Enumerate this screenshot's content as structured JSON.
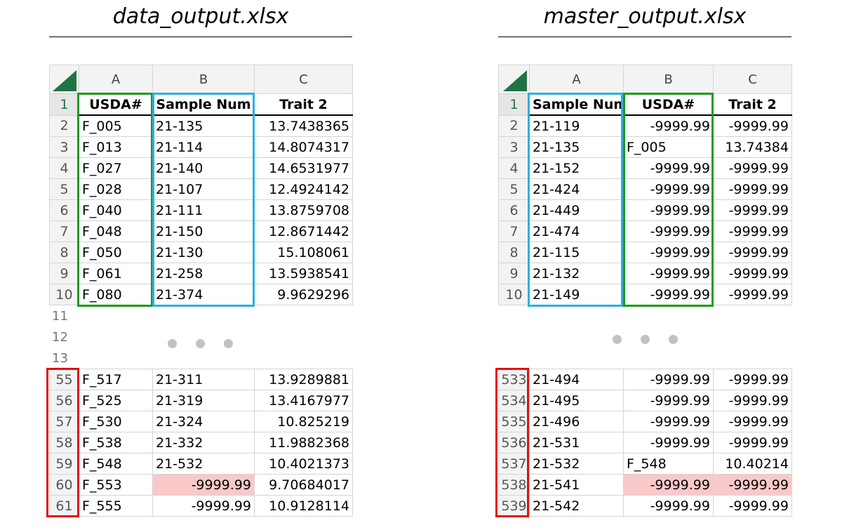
{
  "left": {
    "title": "data_output.xlsx",
    "columns": [
      "A",
      "B",
      "C"
    ],
    "header": [
      "USDA#",
      "Sample Num",
      "Trait 2"
    ],
    "top_rows": [
      {
        "n": "2",
        "a": "F_005",
        "b": "21-135",
        "c": "13.7438365"
      },
      {
        "n": "3",
        "a": "F_013",
        "b": "21-114",
        "c": "14.8074317"
      },
      {
        "n": "4",
        "a": "F_027",
        "b": "21-140",
        "c": "14.6531977"
      },
      {
        "n": "5",
        "a": "F_028",
        "b": "21-107",
        "c": "12.4924142"
      },
      {
        "n": "6",
        "a": "F_040",
        "b": "21-111",
        "c": "13.8759708"
      },
      {
        "n": "7",
        "a": "F_048",
        "b": "21-150",
        "c": "12.8671442"
      },
      {
        "n": "8",
        "a": "F_050",
        "b": "21-130",
        "c": "15.108061"
      },
      {
        "n": "9",
        "a": "F_061",
        "b": "21-258",
        "c": "13.5938541"
      },
      {
        "n": "10",
        "a": "F_080",
        "b": "21-374",
        "c": "9.9629296"
      }
    ],
    "stub_rows": [
      "11",
      "12",
      "13"
    ],
    "bottom_rows": [
      {
        "n": "55",
        "a": "F_517",
        "b": "21-311",
        "c": "13.9289881"
      },
      {
        "n": "56",
        "a": "F_525",
        "b": "21-319",
        "c": "13.4167977"
      },
      {
        "n": "57",
        "a": "F_530",
        "b": "21-324",
        "c": "10.825219"
      },
      {
        "n": "58",
        "a": "F_538",
        "b": "21-332",
        "c": "11.9882368"
      },
      {
        "n": "59",
        "a": "F_548",
        "b": "21-532",
        "c": "10.4021373"
      },
      {
        "n": "60",
        "a": "F_553",
        "b": "-9999.99",
        "c": "9.70684017"
      },
      {
        "n": "61",
        "a": "F_555",
        "b": "-9999.99",
        "c": "10.9128114"
      }
    ]
  },
  "right": {
    "title": "master_output.xlsx",
    "columns": [
      "A",
      "B",
      "C"
    ],
    "header": [
      "Sample Num",
      "USDA#",
      "Trait 2"
    ],
    "top_rows": [
      {
        "n": "2",
        "a": "21-119",
        "b": "-9999.99",
        "c": "-9999.99"
      },
      {
        "n": "3",
        "a": "21-135",
        "b": "F_005",
        "c": "13.74384"
      },
      {
        "n": "4",
        "a": "21-152",
        "b": "-9999.99",
        "c": "-9999.99"
      },
      {
        "n": "5",
        "a": "21-424",
        "b": "-9999.99",
        "c": "-9999.99"
      },
      {
        "n": "6",
        "a": "21-449",
        "b": "-9999.99",
        "c": "-9999.99"
      },
      {
        "n": "7",
        "a": "21-474",
        "b": "-9999.99",
        "c": "-9999.99"
      },
      {
        "n": "8",
        "a": "21-115",
        "b": "-9999.99",
        "c": "-9999.99"
      },
      {
        "n": "9",
        "a": "21-132",
        "b": "-9999.99",
        "c": "-9999.99"
      },
      {
        "n": "10",
        "a": "21-149",
        "b": "-9999.99",
        "c": "-9999.99"
      }
    ],
    "bottom_rows": [
      {
        "n": "533",
        "a": "21-494",
        "b": "-9999.99",
        "c": "-9999.99"
      },
      {
        "n": "534",
        "a": "21-495",
        "b": "-9999.99",
        "c": "-9999.99"
      },
      {
        "n": "535",
        "a": "21-496",
        "b": "-9999.99",
        "c": "-9999.99"
      },
      {
        "n": "536",
        "a": "21-531",
        "b": "-9999.99",
        "c": "-9999.99"
      },
      {
        "n": "537",
        "a": "21-532",
        "b": "F_548",
        "c": "10.40214"
      },
      {
        "n": "538",
        "a": "21-541",
        "b": "-9999.99",
        "c": "-9999.99"
      },
      {
        "n": "539",
        "a": "21-542",
        "b": "-9999.99",
        "c": "-9999.99"
      }
    ]
  },
  "colors": {
    "excel_green": "#217346",
    "usda_box": "#1a9c1a",
    "sample_box": "#2bb0e0",
    "rownum_box": "#e01010",
    "mismatch_fill": "#f9c9c9"
  }
}
